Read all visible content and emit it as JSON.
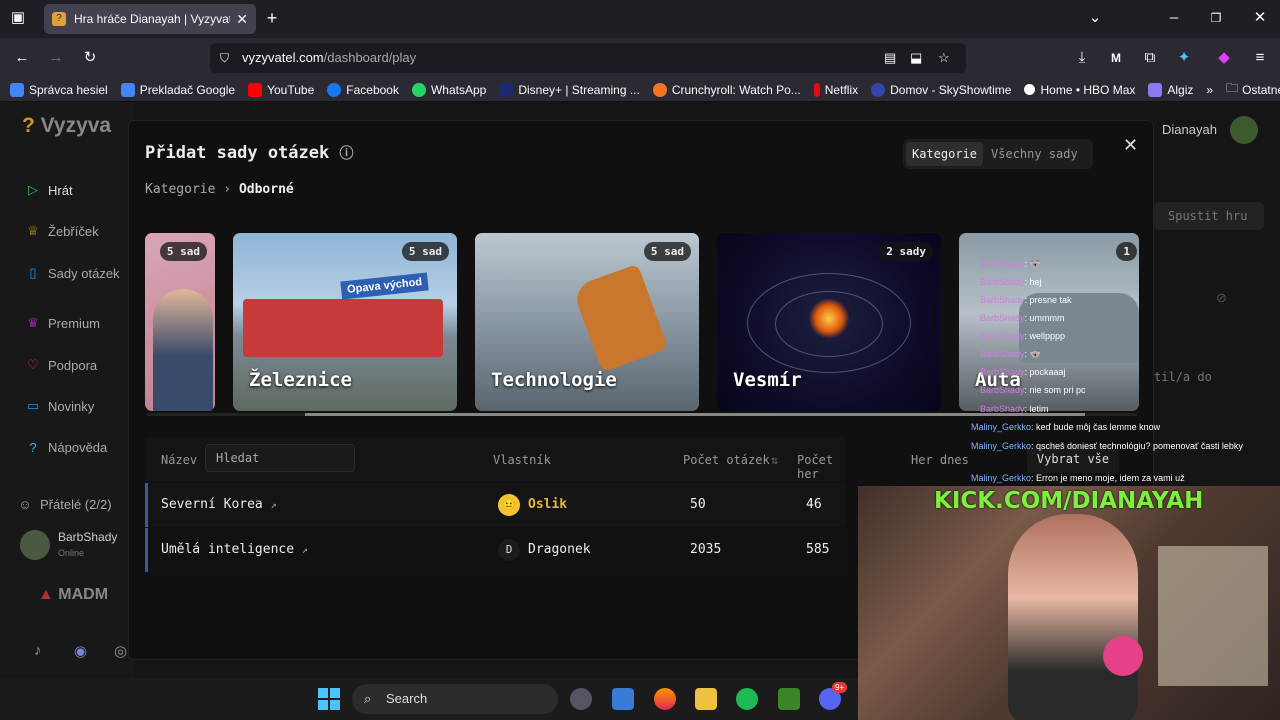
{
  "browser": {
    "tab_title": "Hra hráče Dianayah | Vyzyvatel.",
    "new_tab": "+",
    "url_domain": "vyzyvatel.com",
    "url_path": "/dashboard/play",
    "bookmarks": [
      {
        "label": "Správca hesiel",
        "color": "#4285f4"
      },
      {
        "label": "Prekladač Google",
        "color": "#4285f4"
      },
      {
        "label": "YouTube",
        "color": "#ff0000"
      },
      {
        "label": "Facebook",
        "color": "#1877f2"
      },
      {
        "label": "WhatsApp",
        "color": "#25d366"
      },
      {
        "label": "Disney+ | Streaming ...",
        "color": "#1a2a6c"
      },
      {
        "label": "Crunchyroll: Watch Po...",
        "color": "#f47521"
      },
      {
        "label": "Netflix",
        "color": "#e50914"
      },
      {
        "label": "Domov - SkyShowtime",
        "color": "#3344aa"
      },
      {
        "label": "Home • HBO Max",
        "color": "#ffffff"
      },
      {
        "label": "Algiz",
        "color": "#8a7cf0"
      }
    ],
    "other_bookmarks": "Ostatné záložky"
  },
  "sidebar": {
    "logo": "Vyzyva",
    "items": [
      {
        "label": "Hrát",
        "icon": "play-icon",
        "color": "#4caf50"
      },
      {
        "label": "Žebříček",
        "icon": "trophy-icon",
        "color": "#d4a017"
      },
      {
        "label": "Sady otázek",
        "icon": "book-icon",
        "color": "#2196f3"
      },
      {
        "label": "Premium",
        "icon": "crown-icon",
        "color": "#9c27b0"
      },
      {
        "label": "Podpora",
        "icon": "heart-icon",
        "color": "#e53935"
      },
      {
        "label": "Novinky",
        "icon": "news-icon",
        "color": "#2196f3"
      },
      {
        "label": "Nápověda",
        "icon": "help-icon",
        "color": "#29b6f6"
      }
    ],
    "friends_label": "Přátelé (2/2)",
    "friend_name": "BarbShady",
    "friend_status": "Online",
    "madm": "MADM"
  },
  "header": {
    "user": "Dianayah",
    "start_button": "Spustit hru",
    "partial_text": "til/a do"
  },
  "modal": {
    "title": "Přidat sady otázek",
    "toggle_active": "Kategorie",
    "toggle_inactive": "Všechny sady",
    "breadcrumb_root": "Kategorie",
    "breadcrumb_current": "Odborné",
    "cards": [
      {
        "name": "",
        "badge": "5 sad"
      },
      {
        "name": "Železnice",
        "badge": "5 sad",
        "sign": "Opava východ"
      },
      {
        "name": "Technologie",
        "badge": "5 sad"
      },
      {
        "name": "Vesmír",
        "badge": "2 sady"
      },
      {
        "name": "Auta",
        "badge": "1"
      }
    ],
    "table": {
      "col_name": "Název",
      "search_placeholder": "Hledat",
      "col_owner": "Vlastník",
      "col_questions": "Počet otázek",
      "col_games": "Počet her",
      "col_today": "Her dnes",
      "select_all": "Vybrat vše",
      "rows": [
        {
          "name": "Severní Korea",
          "owner": "Oslik",
          "questions": "50",
          "games": "46"
        },
        {
          "name": "Umělá inteligence",
          "owner": "Dragonek",
          "owner_initial": "D",
          "questions": "2035",
          "games": "585"
        }
      ]
    }
  },
  "stream": {
    "chat": [
      {
        "user": "BarbShady",
        "msg": ": 🐨"
      },
      {
        "user": "BarbShady",
        "msg": ": hej"
      },
      {
        "user": "BarbShady",
        "msg": ": presne tak"
      },
      {
        "user": "BarbShady",
        "msg": ": ummmm"
      },
      {
        "user": "BarbShady",
        "msg": ": wellpppp"
      },
      {
        "user": "BarbShady",
        "msg": ": 🐨"
      },
      {
        "user": "BarbShady",
        "msg": ": pockaaaj"
      },
      {
        "user": "BarbShady",
        "msg": ": nie som pri pc"
      },
      {
        "user": "BarbShady",
        "msg": ": letim"
      },
      {
        "user": "Maliny_Gerkko",
        "msg": ": keď bude môj čas lemme know"
      },
      {
        "user": "Maliny_Gerkko",
        "msg": ": qscheš doniesť technológiu? pomenovať časti lebky"
      },
      {
        "user": "",
        "msg": ""
      },
      {
        "user": "Maliny_Gerkko",
        "msg": ": Erron je meno moje, idem za vami už"
      }
    ],
    "kick_text": "KICK.COM/DIANAYAH"
  },
  "taskbar": {
    "search_label": "Search",
    "discord_badge": "9+"
  }
}
